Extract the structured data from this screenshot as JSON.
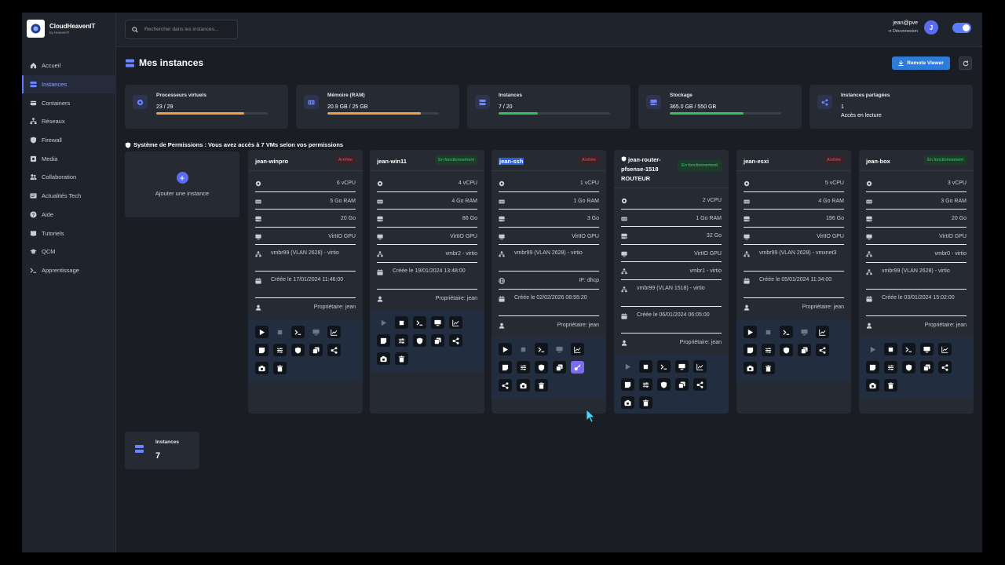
{
  "brand": {
    "name": "CloudHeavenIT",
    "sub": "by HeavenIT"
  },
  "search": {
    "placeholder": "Rechercher dans les instances..."
  },
  "user": {
    "name": "jean@pve",
    "logout": "Déconnexion",
    "avatar": "J"
  },
  "nav": [
    {
      "label": "Accueil",
      "icon": "home-icon"
    },
    {
      "label": "Instances",
      "icon": "server-icon",
      "active": true
    },
    {
      "label": "Containers",
      "icon": "container-icon"
    },
    {
      "label": "Réseaux",
      "icon": "network-icon"
    },
    {
      "label": "Firewall",
      "icon": "shield-icon"
    },
    {
      "label": "Media",
      "icon": "disk-icon"
    },
    {
      "label": "Collaboration",
      "icon": "users-icon"
    },
    {
      "label": "Actualités Tech",
      "icon": "news-icon"
    },
    {
      "label": "Aide",
      "icon": "help-icon"
    },
    {
      "label": "Tutoriels",
      "icon": "book-icon"
    },
    {
      "label": "QCM",
      "icon": "graduation-icon"
    },
    {
      "label": "Apprentissage",
      "icon": "terminal-icon"
    }
  ],
  "page": {
    "title": "Mes instances",
    "remote_viewer": "Remote Viewer"
  },
  "stats": [
    {
      "label": "Processeurs virtuels",
      "value": "23 / 29",
      "fill": 0.79,
      "color": "#f0a04b"
    },
    {
      "label": "Mémoire (RAM)",
      "value": "20.9 GB / 25 GB",
      "fill": 0.84,
      "color": "#f0a04b"
    },
    {
      "label": "Instances",
      "value": "7 / 20",
      "fill": 0.35,
      "color": "#34c25e"
    },
    {
      "label": "Stockage",
      "value": "365.0 GB / 550 GB",
      "fill": 0.66,
      "color": "#34c25e"
    },
    {
      "label": "Instances partagées",
      "value": "1",
      "sub": "Accès en lecture"
    }
  ],
  "permissions": "Système de Permissions : Vous avez accès à 7 VMs selon vos permissions",
  "add_instance": "Ajouter une instance",
  "vms": [
    {
      "name": "jean-winpro",
      "status": "Arrêtée",
      "running": false,
      "specs": [
        "6 vCPU",
        "5 Go RAM",
        "20 Go",
        "VirtIO GPU",
        "vmbr99 (VLAN 2628) - virtio",
        "Créée le 17/01/2024 11:46:00",
        "Propriétaire: jean"
      ]
    },
    {
      "name": "jean-win11",
      "status": "En fonctionnement",
      "running": true,
      "specs": [
        "4 vCPU",
        "4 Go RAM",
        "86 Go",
        "VirtIO GPU",
        "vmbr2 - virtio",
        "Créée le 19/01/2024 13:48:00",
        "Propriétaire: jean"
      ]
    },
    {
      "name": "jean-ssh",
      "status": "Arrêtée",
      "running": false,
      "specs": [
        "1 vCPU",
        "1 Go RAM",
        "3 Go",
        "VirtIO GPU",
        "vmbr99 (VLAN 2628) - virtio",
        "IP: dhcp",
        "Créée le 02/02/2026 08:55:20",
        "Propriétaire: jean"
      ]
    },
    {
      "name": "jean-router-pfsense-1518 ROUTEUR",
      "status": "En fonctionnement",
      "running": true,
      "specs": [
        "2 vCPU",
        "1 Go RAM",
        "32 Go",
        "VirtIO GPU",
        "vmbr1 - virtio",
        "vmbr99 (VLAN 1518) - virtio",
        "Créée le 06/01/2024 06:05:00",
        "Propriétaire: jean"
      ]
    },
    {
      "name": "jean-esxi",
      "status": "Arrêtée",
      "running": false,
      "specs": [
        "5 vCPU",
        "4 Go RAM",
        "196 Go",
        "VirtIO GPU",
        "vmbr99 (VLAN 2628) - vmxnet3",
        "Créée le 05/01/2024 11:34:00",
        "Propriétaire: jean"
      ]
    },
    {
      "name": "jean-box",
      "status": "En fonctionnement",
      "running": true,
      "specs": [
        "3 vCPU",
        "3 Go RAM",
        "20 Go",
        "VirtIO GPU",
        "vmbr0 - virtio",
        "vmbr99 (VLAN 2628) - virtio",
        "Créée le 03/01/2024 15:02:00",
        "Propriétaire: jean"
      ]
    }
  ],
  "instances_count": {
    "label": "Instances",
    "value": "7"
  }
}
